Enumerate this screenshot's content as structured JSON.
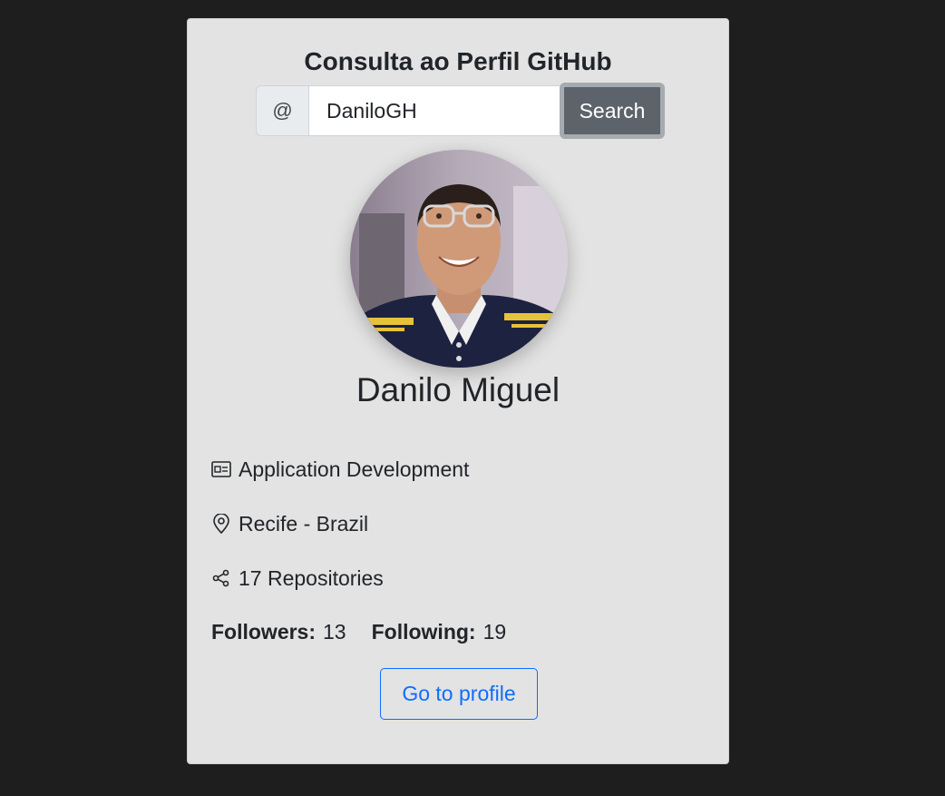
{
  "header": {
    "title": "Consulta ao Perfil GitHub"
  },
  "search": {
    "prefix": "@",
    "value": "DaniloGH",
    "button_label": "Search"
  },
  "profile": {
    "name": "Danilo Miguel",
    "company": "Application Development",
    "location": "Recife - Brazil",
    "repositories": "17 Repositories",
    "followers_label": "Followers:",
    "followers_count": "13",
    "following_label": "Following:",
    "following_count": "19",
    "link_label": "Go to profile"
  },
  "icons": {
    "company": "id-card-icon",
    "location": "map-pin-icon",
    "repositories": "share-icon"
  },
  "colors": {
    "background": "#1e1e1e",
    "card": "#e3e3e3",
    "search_button": "#5c636a",
    "link": "#0d6efd"
  }
}
